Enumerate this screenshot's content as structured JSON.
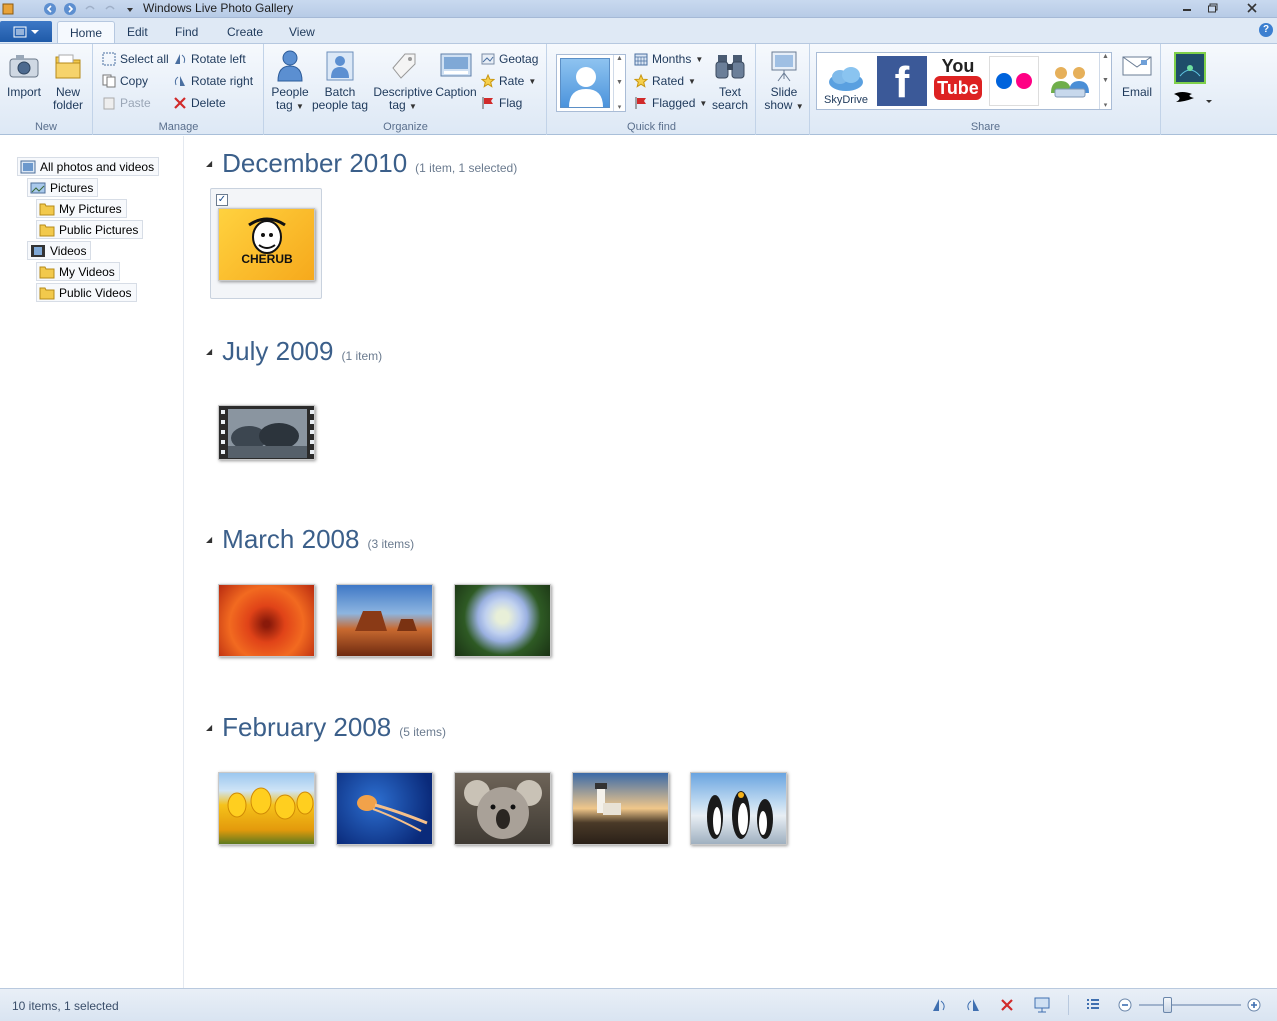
{
  "window": {
    "title": "Windows Live Photo Gallery"
  },
  "tabs": [
    {
      "label": "Home",
      "active": true
    },
    {
      "label": "Edit"
    },
    {
      "label": "Find"
    },
    {
      "label": "Create"
    },
    {
      "label": "View"
    }
  ],
  "ribbon": {
    "new": {
      "label": "New",
      "import": "Import",
      "new_folder_l1": "New",
      "new_folder_l2": "folder"
    },
    "manage": {
      "label": "Manage",
      "select_all": "Select all",
      "copy": "Copy",
      "paste": "Paste",
      "rotate_left": "Rotate left",
      "rotate_right": "Rotate right",
      "delete": "Delete"
    },
    "organize": {
      "label": "Organize",
      "people_tag_l1": "People",
      "people_tag_l2": "tag",
      "batch_l1": "Batch",
      "batch_l2": "people tag",
      "desc_l1": "Descriptive",
      "desc_l2": "tag",
      "caption": "Caption",
      "geotag": "Geotag",
      "rate": "Rate",
      "flag": "Flag"
    },
    "quickfind": {
      "label": "Quick find",
      "months": "Months",
      "rated": "Rated",
      "flagged": "Flagged",
      "text_search_l1": "Text",
      "text_search_l2": "search"
    },
    "slideshow": {
      "l1": "Slide",
      "l2": "show"
    },
    "share": {
      "label": "Share",
      "skydrive": "SkyDrive",
      "youtube_l1": "You",
      "youtube_l2": "Tube",
      "email": "Email"
    }
  },
  "nav": {
    "all": "All photos and videos",
    "pictures": "Pictures",
    "my_pictures": "My Pictures",
    "public_pictures": "Public Pictures",
    "videos": "Videos",
    "my_videos": "My Videos",
    "public_videos": "Public Videos"
  },
  "sections": [
    {
      "title": "December 2010",
      "count": "(1 item, 1 selected)"
    },
    {
      "title": "July 2009",
      "count": "(1 item)"
    },
    {
      "title": "March 2008",
      "count": "(3 items)"
    },
    {
      "title": "February 2008",
      "count": "(5 items)"
    }
  ],
  "cherub_text": "CHERUB",
  "status": {
    "text": "10 items, 1 selected"
  },
  "colors": {
    "accent": "#3b5f8a",
    "ribbon_bg": "#dde8f5",
    "file_button": "#1f5aa8"
  }
}
